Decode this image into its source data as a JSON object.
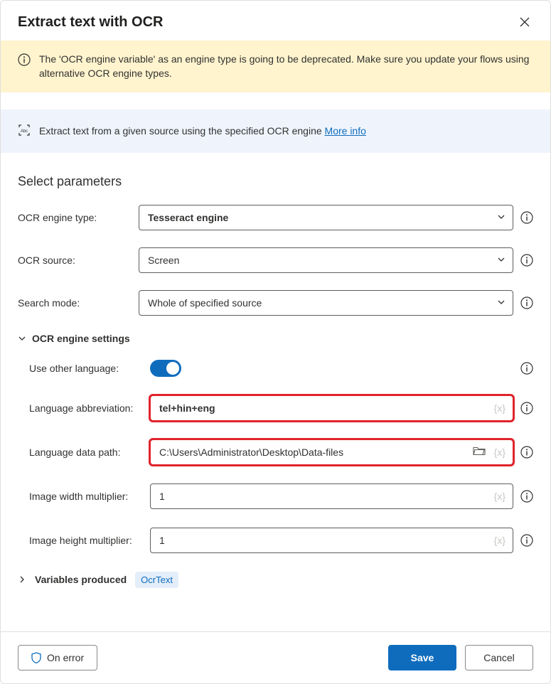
{
  "header": {
    "title": "Extract text with OCR"
  },
  "warning": {
    "text": "The 'OCR engine variable' as an engine type is going to be deprecated.  Make sure you update your flows using alternative OCR engine types."
  },
  "info": {
    "text": "Extract text from a given source using the specified OCR engine ",
    "link": "More info"
  },
  "section_title": "Select parameters",
  "fields": {
    "engine_type": {
      "label": "OCR engine type:",
      "value": "Tesseract engine"
    },
    "ocr_source": {
      "label": "OCR source:",
      "value": "Screen"
    },
    "search_mode": {
      "label": "Search mode:",
      "value": "Whole of specified source"
    }
  },
  "engine_settings": {
    "header": "OCR engine settings",
    "use_other_language": {
      "label": "Use other language:",
      "on": true
    },
    "lang_abbrev": {
      "label": "Language abbreviation:",
      "value": "tel+hin+eng"
    },
    "lang_path": {
      "label": "Language data path:",
      "value": "C:\\Users\\Administrator\\Desktop\\Data-files"
    },
    "width_mult": {
      "label": "Image width multiplier:",
      "value": "1"
    },
    "height_mult": {
      "label": "Image height multiplier:",
      "value": "1"
    }
  },
  "variables": {
    "label": "Variables produced",
    "badge": "OcrText"
  },
  "footer": {
    "on_error": "On error",
    "save": "Save",
    "cancel": "Cancel"
  },
  "var_placeholder": "{x}"
}
